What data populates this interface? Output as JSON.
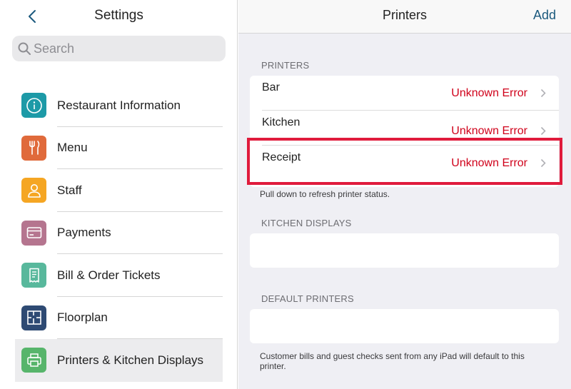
{
  "left": {
    "title": "Settings",
    "search_placeholder": "Search",
    "items": [
      {
        "label": "Restaurant Information",
        "icon": "info-icon",
        "color": "#1d9aa7"
      },
      {
        "label": "Menu",
        "icon": "fork-knife-icon",
        "color": "#e06a3b"
      },
      {
        "label": "Staff",
        "icon": "person-icon",
        "color": "#f5a623"
      },
      {
        "label": "Payments",
        "icon": "card-icon",
        "color": "#b5758f"
      },
      {
        "label": "Bill & Order Tickets",
        "icon": "receipt-icon",
        "color": "#58b89c"
      },
      {
        "label": "Floorplan",
        "icon": "floorplan-icon",
        "color": "#2e4a73"
      },
      {
        "label": "Printers & Kitchen Displays",
        "icon": "printer-icon",
        "color": "#57b56b"
      }
    ]
  },
  "right": {
    "title": "Printers",
    "add_label": "Add",
    "printers_header": "PRINTERS",
    "printers": [
      {
        "name": "Bar",
        "status": "Unknown Error"
      },
      {
        "name": "Kitchen",
        "status": "Unknown Error"
      },
      {
        "name": "Receipt",
        "status": "Unknown Error"
      }
    ],
    "refresh_note": "Pull down to refresh printer status.",
    "kitchen_displays_header": "KITCHEN DISPLAYS",
    "default_printers_header": "DEFAULT PRINTERS",
    "default_note": "Customer bills and guest checks sent from any iPad will default to this printer."
  },
  "colors": {
    "accent": "#1c5a7e",
    "error": "#d0021b",
    "highlight": "#e01b3c"
  }
}
